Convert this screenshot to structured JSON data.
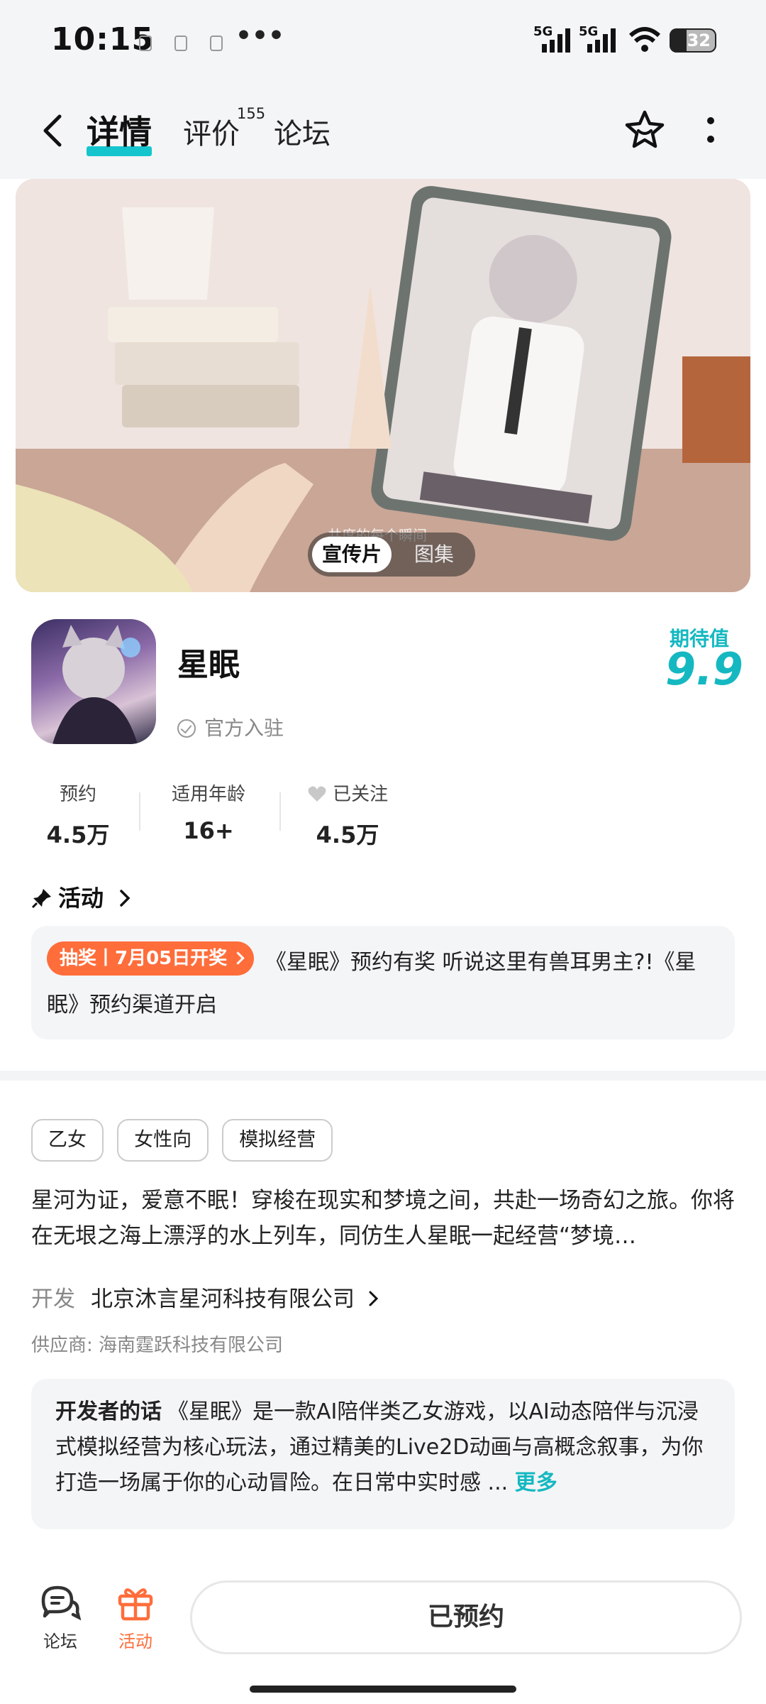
{
  "status_bar": {
    "time": "10:15",
    "network_1": "5G",
    "network_2": "5G",
    "battery": "32"
  },
  "nav": {
    "tabs": [
      {
        "label": "详情",
        "active": true
      },
      {
        "label": "评价",
        "active": false
      },
      {
        "label": "论坛",
        "active": false
      }
    ],
    "review_count": "155",
    "icons": [
      "back-icon",
      "star-icon",
      "more-vertical-icon"
    ],
    "accent": "#15c5ce"
  },
  "banner": {
    "caption": "共度的每个瞬间",
    "toggle": [
      "宣传片",
      "图集"
    ],
    "selected_toggle": "宣传片"
  },
  "game": {
    "name": "星眠",
    "official_label": "官方入驻",
    "expect_label": "期待值",
    "expect_value": "9.9",
    "stats": [
      {
        "label": "预约",
        "value": "4.5万"
      },
      {
        "label": "适用年龄",
        "value": "16+"
      },
      {
        "label": "已关注",
        "value": "4.5万"
      }
    ]
  },
  "activity": {
    "heading": "活动",
    "badge": "抽奖丨7月05日开奖",
    "text": "《星眠》预约有奖 听说这里有兽耳男主?!《星眠》预约渠道开启",
    "badge_color": "#ff6d3b"
  },
  "tags": [
    "乙女",
    "女性向",
    "模拟经营"
  ],
  "description": "星河为证，爱意不眠！穿梭在现实和梦境之间，共赴一场奇幻之旅。你将在无垠之海上漂浮的水上列车，同仿生人星眠一起经营“梦境…",
  "developer": {
    "label": "开发",
    "name": "北京沐言星河科技有限公司"
  },
  "supplier": "供应商: 海南霆跃科技有限公司",
  "developer_note": {
    "title": "开发者的话",
    "text": "《星眠》是一款AI陪伴类乙女游戏，以AI动态陪伴与沉浸式模拟经营为核心玩法，通过精美的Live2D动画与高概念叙事，为你打造一场属于你的心动冒险。在日常中实时感 ...",
    "more": "更多"
  },
  "bottom_bar": {
    "forum": "论坛",
    "activity": "活动",
    "reserve_button": "已预约"
  }
}
